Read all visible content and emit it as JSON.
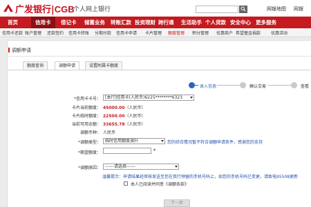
{
  "header": {
    "brand_cn": "广发银行",
    "brand_sep": "|",
    "brand_en": "CGB",
    "subtitle": "个人网上银行",
    "links": [
      "网银地图",
      "网银"
    ]
  },
  "nav": {
    "items": [
      "首页",
      "信用卡",
      "借记卡",
      "储蓄业务",
      "转账汇款",
      "投资理财",
      "跨行通",
      "生活助手",
      "个人贷款",
      "安全中心",
      "更多服务"
    ],
    "active_index": 1
  },
  "subnav": {
    "items": [
      "信用卡还款",
      "账户管理",
      "还款签约",
      "信用卡转账",
      "分期付款",
      "信用卡申请",
      "卡片管理",
      "额度管理",
      "积分管理",
      "优惠商户",
      "希望基金捐款",
      "优惠活动"
    ],
    "active_index": 7
  },
  "page": {
    "title": "调额申请",
    "tabs": [
      "额度查询",
      "调额申请",
      "设置附属卡额度"
    ],
    "active_tab": 1
  },
  "steps": [
    "录入信息",
    "确认交易",
    "查看"
  ],
  "form": {
    "card_label": "信用卡卡号：",
    "card_value": "[本行]信用卡(人民币)6225********6323",
    "current_limit_label": "卡片当前额度：",
    "current_limit_value": "45000.00",
    "temp_limit_label": "卡片临时额度：",
    "temp_limit_value": "22500.00",
    "available_label": "当前可用余额：",
    "available_value": "33655.78",
    "currency_note": "（人民币）",
    "adjust_currency_label": "调额币种：",
    "adjust_currency_value": "人民币",
    "adjust_type_label": "调额类型：",
    "adjust_type_value": "临时信用额度调升",
    "adjust_type_hint": "您的综合情况暂不符合调额申请条件，感谢您的支持",
    "expected_limit_label": "期望额度：",
    "expected_limit_value": "",
    "reason_label": "调额原因：",
    "reason_value": "------请选择------",
    "notice_label": "温馨提示：",
    "notice_text": "申请结果经审核发送至您在我行预留的手机号码上，如您的手机号码已变更，请致电95508更新",
    "agree_text": "本人已阅读并同意《调额条款》",
    "next_label": "下一步"
  }
}
